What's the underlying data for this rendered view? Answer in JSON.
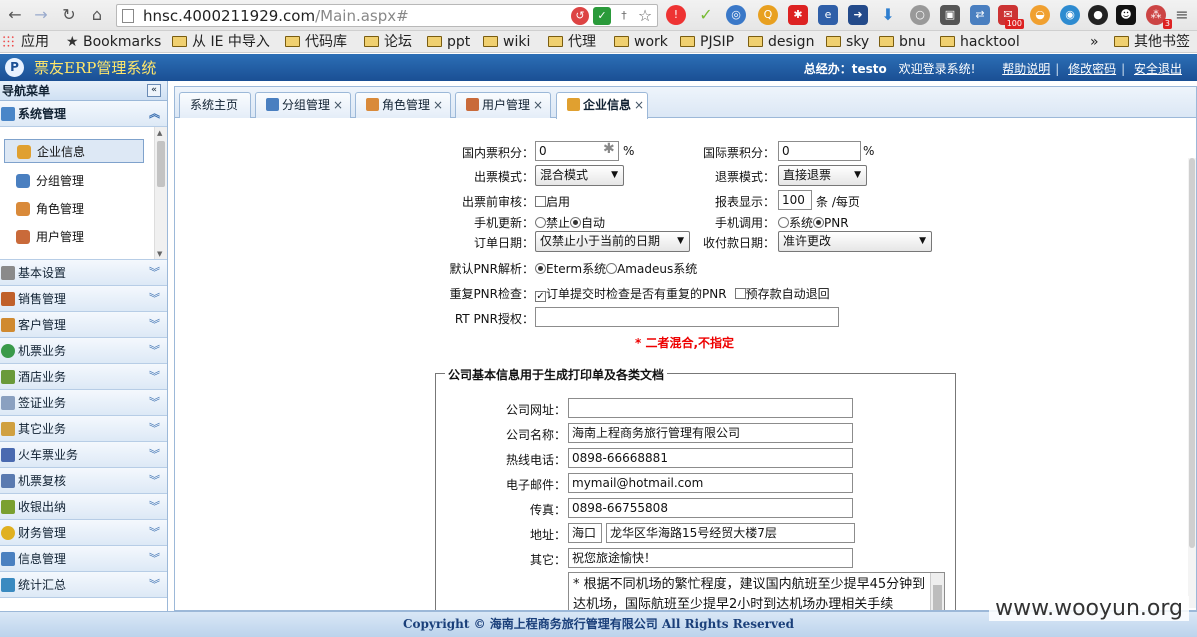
{
  "browser": {
    "url_host": "hnsc.4000211929.com",
    "url_path": "/Main.aspx#",
    "ext_badge_mail": "100",
    "ext_badge_last": "3"
  },
  "bookmarks": {
    "apps": "应用",
    "bookmarks": "Bookmarks",
    "items": [
      "从 IE 中导入",
      "代码库",
      "论坛",
      "ppt",
      "wiki",
      "代理",
      "work",
      "PJSIP",
      "design",
      "sky",
      "bnu",
      "hacktool"
    ],
    "more": "»",
    "other": "其他书签"
  },
  "header": {
    "title": "票友ERP管理系统",
    "user_label": "总经办：",
    "user_name": "testo",
    "welcome": "欢迎登录系统!",
    "links": [
      "帮助说明",
      "修改密码",
      "安全退出"
    ]
  },
  "sidebar": {
    "title": "导航菜单",
    "open_group": "系统管理",
    "sub_items": [
      "企业信息",
      "分组管理",
      "角色管理",
      "用户管理"
    ],
    "groups": [
      "基本设置",
      "销售管理",
      "客户管理",
      "机票业务",
      "酒店业务",
      "签证业务",
      "其它业务",
      "火车票业务",
      "机票复核",
      "收银出纳",
      "财务管理",
      "信息管理",
      "统计汇总"
    ]
  },
  "tabs": [
    "系统主页",
    "分组管理",
    "角色管理",
    "用户管理",
    "企业信息"
  ],
  "form": {
    "domestic_points_label": "国内票积分：",
    "domestic_points_value": "0",
    "intl_points_label": "国际票积分：",
    "intl_points_value": "0",
    "percent": "%",
    "issue_mode_label": "出票模式：",
    "issue_mode_value": "混合模式",
    "refund_mode_label": "退票模式：",
    "refund_mode_value": "直接退票",
    "pre_audit_label": "出票前审核：",
    "pre_audit_option": "启用",
    "report_label": "报表显示：",
    "report_value": "100",
    "report_unit": "条 /每页",
    "phone_update_label": "手机更新：",
    "phone_update_opt1": "禁止",
    "phone_update_opt2": "自动",
    "phone_call_label": "手机调用：",
    "phone_call_opt1": "系统",
    "phone_call_opt2": "PNR",
    "order_date_label": "订单日期：",
    "order_date_value": "仅禁止小于当前的日期",
    "payment_date_label": "收付款日期：",
    "payment_date_value": "准许更改",
    "pnr_parse_label": "默认PNR解析：",
    "pnr_parse_opt1": "Eterm系统",
    "pnr_parse_opt2": "Amadeus系统",
    "dup_pnr_label": "重复PNR检查：",
    "dup_pnr_opt1": "订单提交时检查是否有重复的PNR",
    "dup_pnr_opt2": "预存款自动退回",
    "rt_pnr_label": "RT PNR授权：",
    "rt_pnr_value": "",
    "warning": "* 二者混合,不指定"
  },
  "company": {
    "legend": "公司基本信息用于生成打印单及各类文档",
    "website_label": "公司网址：",
    "website_value": "",
    "name_label": "公司名称：",
    "name_value": "海南上程商务旅行管理有限公司",
    "hotline_label": "热线电话：",
    "hotline_value": "0898-66668881",
    "email_label": "电子邮件：",
    "email_value": "mymail@hotmail.com",
    "fax_label": "传真：",
    "fax_value": "0898-66755808",
    "address_label": "地址：",
    "address_city": "海口",
    "address_street": "龙华区华海路15号经贸大楼7层",
    "other_label": "其它：",
    "other_value": "祝您旅途愉快！",
    "notes_value": "* 根据不同机场的繁忙程度，建议国内航班至少提早45分钟到达机场，国际航班至少提早2小时到达机场办理相关手续"
  },
  "footer": "Copyright © 海南上程商务旅行管理有限公司 All Rights Reserved",
  "watermark": "www.wooyun.org"
}
